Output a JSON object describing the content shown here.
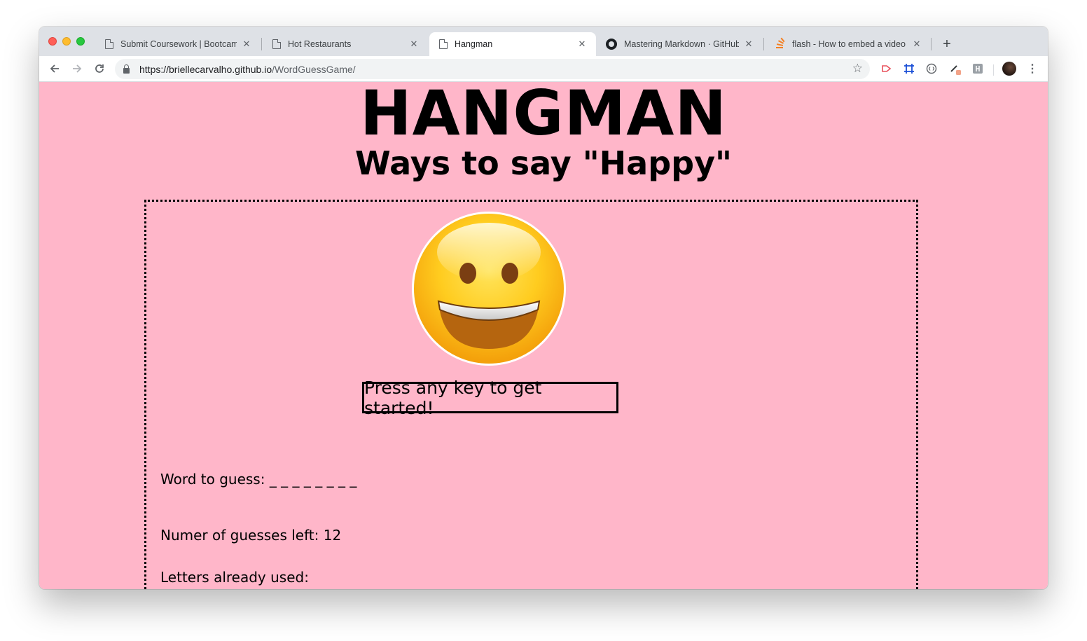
{
  "browser": {
    "tabs": [
      {
        "title": "Submit Coursework | Bootcamp",
        "icon": "page-icon",
        "active": false
      },
      {
        "title": "Hot Restaurants",
        "icon": "page-icon",
        "active": false
      },
      {
        "title": "Hangman",
        "icon": "page-icon",
        "active": true
      },
      {
        "title": "Mastering Markdown · GitHub Guides",
        "icon": "github-icon",
        "active": false
      },
      {
        "title": "flash - How to embed a video into",
        "icon": "stackoverflow-icon",
        "active": false
      }
    ],
    "new_tab": "+",
    "url": {
      "host": "https://briellecarvalho.github.io",
      "path": "/WordGuessGame/"
    },
    "close_glyph": "✕"
  },
  "page": {
    "title": "HANGMAN",
    "subtitle": "Ways to say \"Happy\"",
    "prompt": "Press any key to get started!",
    "word_label": "Word to guess:",
    "word_value": "_ _ _ _ _ _ _ _",
    "guesses_label": "Numer of guesses left:",
    "guesses_value": "12",
    "letters_label": "Letters already used:",
    "letters_value": ""
  },
  "colors": {
    "page_background": "#ffb6c9",
    "tabstrip": "#dee1e6"
  }
}
